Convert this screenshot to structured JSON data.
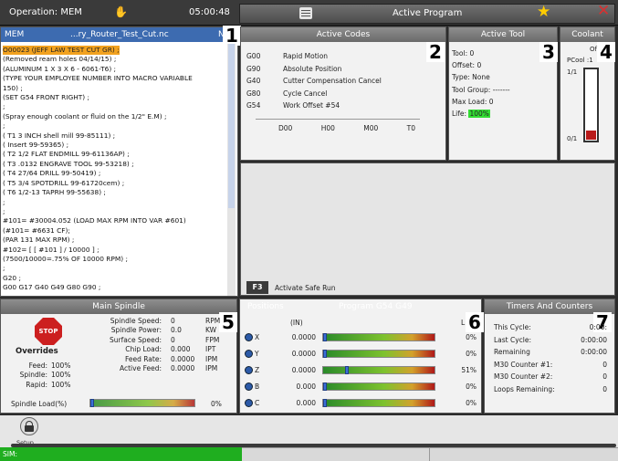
{
  "title_bar": {
    "operation": "Operation: MEM",
    "clock": "05:00:48",
    "active_program_title": "Active Program"
  },
  "program": {
    "tab_mode": "MEM",
    "tab_file": "...ry_Router_Test_Cut.nc",
    "tab_suffix": "N",
    "first_line": "O00023 (JEFF LAW TEST CUT GR) ;",
    "lines": [
      "(Removed ream holes 04/14/15) ;",
      "(ALUMINUM 1 X 3 X 6 - 6061-T6) ;",
      "(TYPE YOUR EMPLOYEE NUMBER INTO MACRO VARIABLE",
      "150) ;",
      "(SET G54 FRONT RIGHT) ;",
      ";",
      "(Spray enough coolant or fluid on the 1/2\" E.M) ;",
      ";",
      "( T1 3 INCH shell mill 99-85111) ;",
      "( Insert 99-59365) ;",
      "( T2 1/2 FLAT ENDMILL 99-61136AP) ;",
      "( T3 .0132 ENGRAVE TOOL 99-53218) ;",
      "( T4 27/64 DRILL 99-50419) ;",
      "( T5 3/4 SPOTDRILL 99-61720cem) ;",
      "( T6 1/2-13 TAPRH 99-55638) ;",
      ";",
      ";",
      "#101= #30004.052 (LOAD MAX RPM INTO VAR #601)",
      "(#101= #6631 CF);",
      "(PAR 131 MAX RPM) ;",
      "#102= [ [ #101 ] / 10000 ] ;",
      "(7500/10000=.75% OF 10000 RPM) ;",
      ";",
      "G20 ;",
      "G00 G17 G40 G49 G80 G90 ;",
      ";",
      "N10 ;"
    ]
  },
  "active_codes": {
    "header": "Active Codes",
    "codes": [
      {
        "code": "G00",
        "desc": "Rapid Motion"
      },
      {
        "code": "G90",
        "desc": "Absolute Position"
      },
      {
        "code": "G40",
        "desc": "Cutter Compensation Cancel"
      },
      {
        "code": "G80",
        "desc": "Cycle Cancel"
      },
      {
        "code": "G54",
        "desc": "Work Offset #54"
      }
    ],
    "bottom": [
      "D00",
      "H00",
      "M00",
      "T0"
    ]
  },
  "active_tool": {
    "header": "Active Tool",
    "tool": "Tool: 0",
    "offset": "Offset: 0",
    "type": "Type: None",
    "tool_group": "Tool Group: -------",
    "max_load": "Max Load: 0",
    "life_label": "Life:",
    "life_value": "100%"
  },
  "coolant": {
    "header": "Coolant",
    "off": "Of",
    "pcool": "PCool :1",
    "top": "1/1",
    "bottom": "0/1"
  },
  "safe_run": {
    "key": "F3",
    "label": "Activate Safe Run"
  },
  "spindle": {
    "header": "Main Spindle",
    "overrides_label": "Overrides",
    "stop_label": "STOP",
    "stats": [
      {
        "label": "Spindle Speed:",
        "value": "0",
        "unit": "RPM"
      },
      {
        "label": "Spindle Power:",
        "value": "0.0",
        "unit": "KW"
      },
      {
        "label": "Surface Speed:",
        "value": "0",
        "unit": "FPM"
      },
      {
        "label": "Chip Load:",
        "value": "0.000",
        "unit": "IPT"
      },
      {
        "label": "Feed Rate:",
        "value": "0.0000",
        "unit": "IPM"
      },
      {
        "label": "Active Feed:",
        "value": "0.0000",
        "unit": "IPM"
      }
    ],
    "overrides": [
      {
        "label": "Feed:",
        "value": "100%"
      },
      {
        "label": "Spindle:",
        "value": "100%"
      },
      {
        "label": "Rapid:",
        "value": "100%"
      }
    ],
    "load_label": "Spindle Load(%)",
    "load_value": "0%",
    "load_fraction": 0.0
  },
  "positions": {
    "header_left": "Positions",
    "header_right": "Program G54 G49",
    "unit": "(IN)",
    "unit_right": "L",
    "axes": [
      {
        "axis": "X",
        "value": "0.0000",
        "load": "0%",
        "marker": 0.0
      },
      {
        "axis": "Y",
        "value": "0.0000",
        "load": "0%",
        "marker": 0.0
      },
      {
        "axis": "Z",
        "value": "0.0000",
        "load": "51%",
        "marker": 0.2
      },
      {
        "axis": "B",
        "value": "0.000",
        "load": "0%",
        "marker": 0.0
      },
      {
        "axis": "C",
        "value": "0.000",
        "load": "0%",
        "marker": 0.0
      }
    ]
  },
  "timers": {
    "header": "Timers And Counters",
    "rows": [
      {
        "label": "This Cycle:",
        "value": "0:00:"
      },
      {
        "label": "Last Cycle:",
        "value": "0:00:00"
      },
      {
        "label": "Remaining",
        "value": "0:00:00"
      },
      {
        "label": "M30 Counter #1:",
        "value": "0"
      },
      {
        "label": "M30 Counter #2:",
        "value": "0"
      },
      {
        "label": "Loops Remaining:",
        "value": "0"
      }
    ]
  },
  "setup": {
    "label": "Setup"
  },
  "status": {
    "sim": "SIM:"
  },
  "badges": [
    "1",
    "2",
    "3",
    "4",
    "5",
    "6",
    "7"
  ],
  "colors": {
    "highlight_orange": "#f2a21f",
    "life_green": "#33dd33",
    "status_green": "#1fae1f",
    "tab_blue": "#3d6bb0"
  }
}
